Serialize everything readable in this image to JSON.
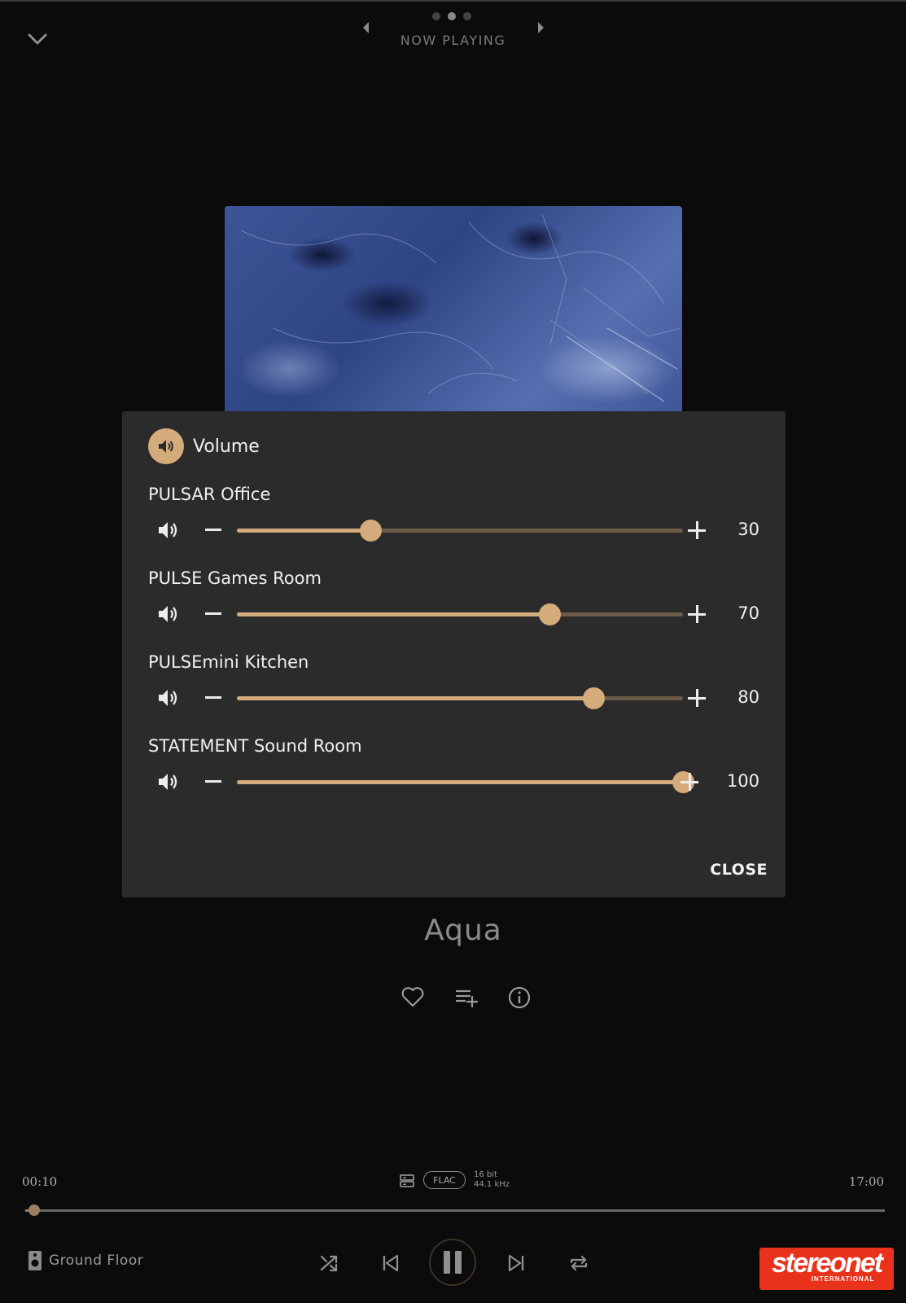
{
  "header": {
    "title": "NOW PLAYING",
    "page_count": 3,
    "active_page": 2
  },
  "volume_dialog": {
    "title": "Volume",
    "close_label": "CLOSE",
    "zones": [
      {
        "name": "PULSAR Office",
        "volume": 30,
        "volume_label": "30"
      },
      {
        "name": "PULSE Games Room",
        "volume": 70,
        "volume_label": "70"
      },
      {
        "name": "PULSEmini Kitchen",
        "volume": 80,
        "volume_label": "80"
      },
      {
        "name": "STATEMENT Sound Room",
        "volume": 100,
        "volume_label": "100"
      }
    ]
  },
  "track": {
    "title": "Aqua"
  },
  "playback": {
    "elapsed": "00:10",
    "duration": "17:00",
    "format": "FLAC",
    "bit_depth": "16 bit",
    "sample_rate": "44.1 kHz",
    "progress_fraction": 0.01
  },
  "zone_selector": {
    "label": "Ground Floor"
  },
  "logo": {
    "main": "stereonet",
    "sub": "INTERNATIONAL"
  },
  "colors": {
    "accent": "#d4ab7b",
    "background": "#0b0b0b",
    "dialog": "#2b2b2b",
    "logo": "#e8321b"
  },
  "icons": [
    "chevron-down-icon",
    "arrow-left-icon",
    "arrow-right-icon",
    "speaker-icon",
    "heart-icon",
    "playlist-add-icon",
    "info-icon",
    "server-icon",
    "shuffle-icon",
    "previous-icon",
    "pause-icon",
    "next-icon",
    "repeat-icon"
  ]
}
